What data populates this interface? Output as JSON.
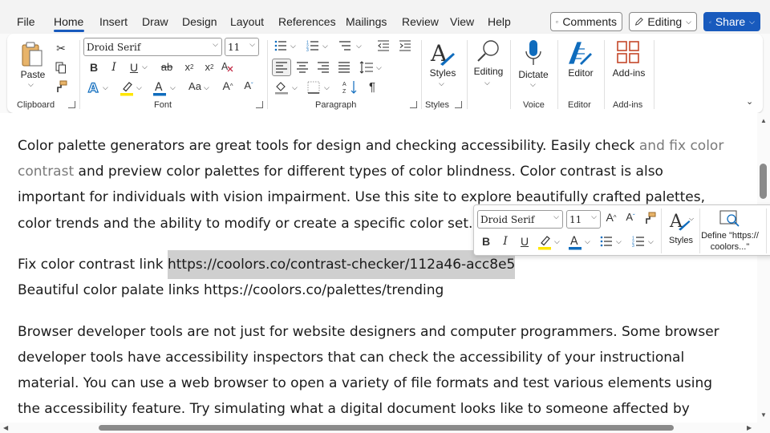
{
  "menu": {
    "tabs": [
      "File",
      "Home",
      "Insert",
      "Draw",
      "Design",
      "Layout",
      "References",
      "Mailings",
      "Review",
      "View",
      "Help"
    ],
    "active_tab": "Home",
    "comments_label": "Comments",
    "editing_label": "Editing",
    "share_label": "Share"
  },
  "ribbon": {
    "groups": {
      "clipboard": "Clipboard",
      "font": "Font",
      "paragraph": "Paragraph",
      "styles": "Styles",
      "voice": "Voice",
      "editor": "Editor",
      "addins": "Add-ins"
    },
    "paste_label": "Paste",
    "font_name": "Droid Serif",
    "font_size": "11",
    "styles_label": "Styles",
    "editing_label": "Editing",
    "dictate_label": "Dictate",
    "editor_label": "Editor",
    "addins_label": "Add-ins",
    "accent_color": "#185abd",
    "highlight_color": "#ffe600",
    "font_color": "#0f6cbd"
  },
  "document": {
    "p1": {
      "l1a": "Color palette generators are great tools for design and checking accessibility. Easily check ",
      "l1b": "and fix color",
      "l2a": "contrast",
      "l2b": " and preview color palettes for different types of color blindness. Color contrast is also",
      "l3": "important for individuals with vision impairment. Use this site to explore beautifully crafted palettes,",
      "l4": "color trends and the ability to modify or create a specific color set."
    },
    "links": {
      "fix_prefix": "Fix color contrast link ",
      "fix_url": "https://coolors.co/contrast-checker/112a46-acc8e5",
      "palate_line": "Beautiful color palate links https://coolors.co/palettes/trending"
    },
    "p2": {
      "l1": "Browser developer tools are not just for website designers and computer programmers. Some browser",
      "l2": "developer tools have accessibility inspectors that can check the accessibility of your instructional",
      "l3": "material. You can use a web browser to open a variety of file formats and test various elements using",
      "l4": "the accessibility feature. Try simulating what a digital document looks like to someone affected by"
    }
  },
  "mini_toolbar": {
    "font_name": "Droid Serif",
    "font_size": "11",
    "styles_label": "Styles",
    "define_label_1": "Define \"https://",
    "define_label_2": "coolors...\""
  }
}
